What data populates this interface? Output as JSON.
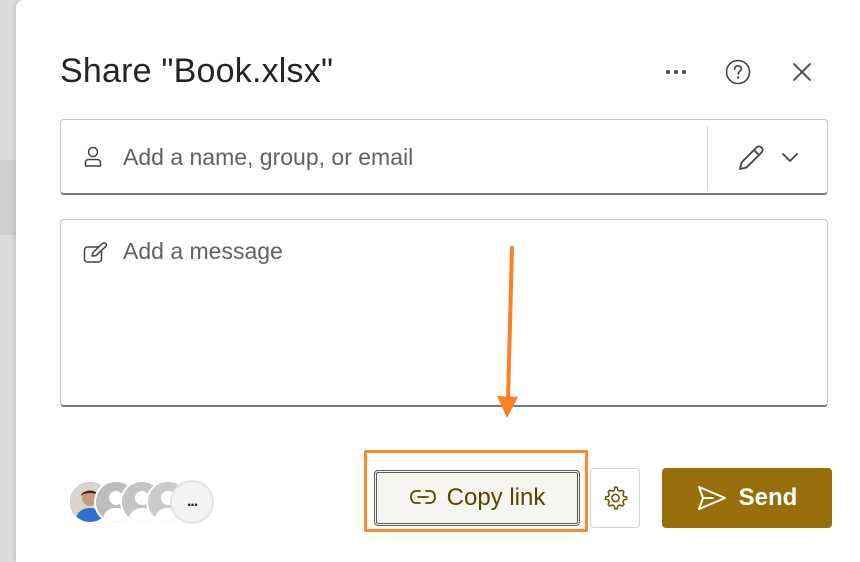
{
  "dialog": {
    "title": "Share \"Book.xlsx\"",
    "more_icon": "more-horizontal-icon",
    "help_icon": "question-circle-icon",
    "close_icon": "dismiss-icon"
  },
  "recipients": {
    "placeholder": "Add a name, group, or email",
    "person_icon": "person-icon",
    "permission_icon": "pencil-edit-icon",
    "dropdown_icon": "chevron-down-icon"
  },
  "message": {
    "placeholder": "Add a message",
    "icon": "compose-icon"
  },
  "shared_with": {
    "more_label": "..."
  },
  "actions": {
    "copy_link_label": "Copy link",
    "copy_link_icon": "link-icon",
    "settings_icon": "gear-icon",
    "send_label": "Send",
    "send_icon": "send-icon"
  },
  "colors": {
    "send_background": "#986f0b",
    "highlight": "#ff8a2a",
    "copy_link_text": "#5b4300"
  }
}
